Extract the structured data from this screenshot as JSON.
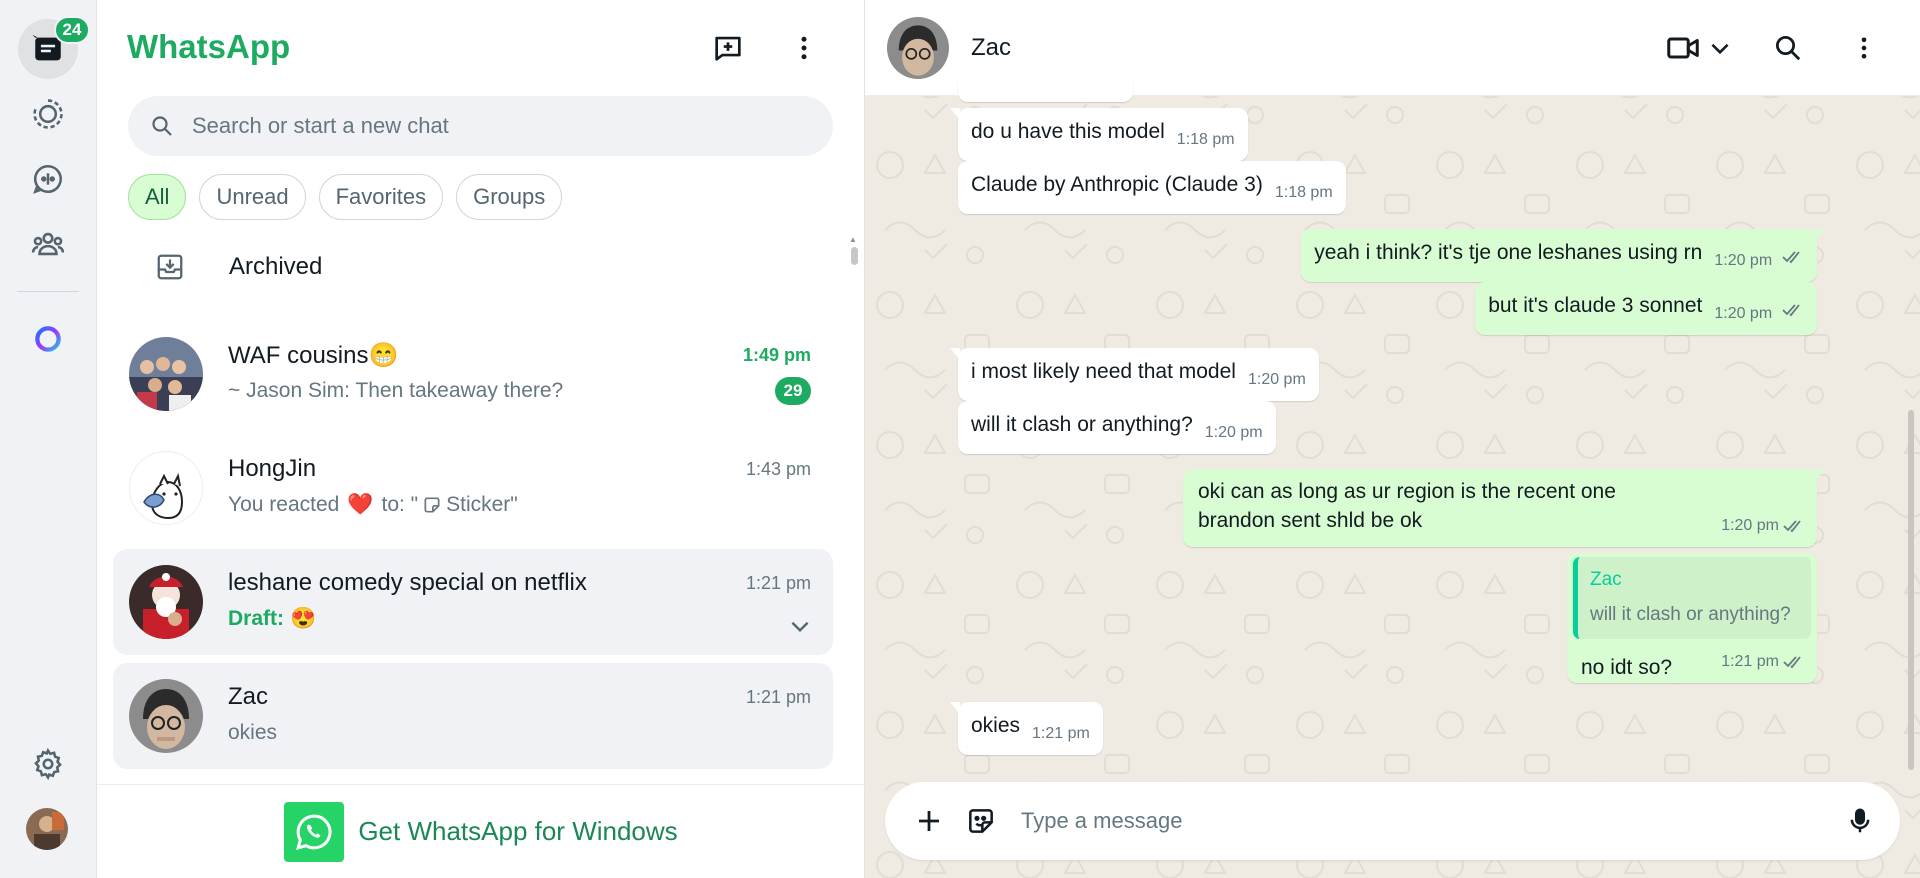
{
  "rail": {
    "chats_badge": "24"
  },
  "header": {
    "app_title": "WhatsApp"
  },
  "search": {
    "placeholder": "Search or start a new chat"
  },
  "filters": [
    "All",
    "Unread",
    "Favorites",
    "Groups"
  ],
  "archived_label": "Archived",
  "chats": [
    {
      "name": "WAF cousins",
      "emoji": "😁",
      "preview": "~ Jason Sim: Then takeaway there?",
      "time": "1:49 pm",
      "unread": "29"
    },
    {
      "name": "HongJin",
      "preview_prefix": "You reacted",
      "reaction": "❤️",
      "preview_suffix": "to: \"",
      "sticker_label": "Sticker\"",
      "time": "1:43 pm"
    },
    {
      "name": "leshane comedy special on netflix",
      "draft_label": "Draft:",
      "draft_emoji": "😍",
      "time": "1:21 pm"
    },
    {
      "name": "Zac",
      "preview": "okies",
      "time": "1:21 pm"
    }
  ],
  "get_app_label": "Get WhatsApp for Windows",
  "conversation": {
    "contact_name": "Zac",
    "messages": [
      {
        "dir": "in",
        "text": "do u have this model",
        "time": "1:18 pm"
      },
      {
        "dir": "in",
        "text": "Claude by Anthropic (Claude 3)",
        "time": "1:18 pm"
      },
      {
        "dir": "out",
        "text": "yeah i think? it's tje one leshanes using rn",
        "time": "1:20 pm"
      },
      {
        "dir": "out",
        "text": "but it's claude 3 sonnet",
        "time": "1:20 pm"
      },
      {
        "dir": "in",
        "text": "i most likely need that model",
        "time": "1:20 pm"
      },
      {
        "dir": "in",
        "text": "will it clash or anything?",
        "time": "1:20 pm"
      },
      {
        "dir": "out",
        "text": "oki can as long as ur region is the recent one brandon sent shld be ok",
        "time": "1:20 pm"
      },
      {
        "dir": "out",
        "quote_name": "Zac",
        "quote_text": "will it clash or anything?",
        "text": "no idt so?",
        "time": "1:21 pm"
      },
      {
        "dir": "in",
        "text": "okies",
        "time": "1:21 pm"
      }
    ],
    "composer_placeholder": "Type a message"
  },
  "colors": {
    "brand_green": "#1daa61",
    "outgoing_bubble": "#d9fdd3",
    "chat_background": "#efeae2"
  }
}
